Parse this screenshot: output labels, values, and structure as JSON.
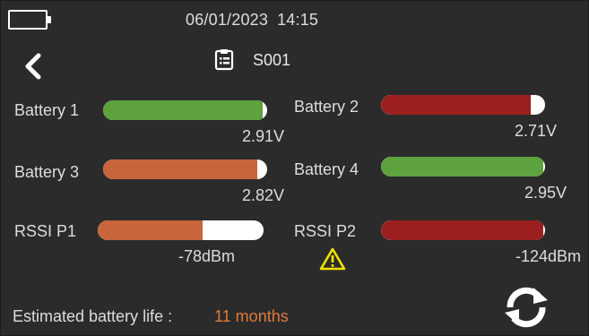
{
  "header": {
    "date": "06/01/2023",
    "time": "14:15",
    "device_battery_icon": "battery-outline-icon"
  },
  "sensor": {
    "id": "S001",
    "icon": "clipboard-icon"
  },
  "nav": {
    "back_icon": "chevron-left-icon"
  },
  "colors": {
    "green": "#5da23d",
    "red": "#9b1f1f",
    "orange": "#c9653a",
    "accent_orange": "#e07a3a",
    "warning_yellow": "#f2e200"
  },
  "gauges": [
    {
      "label": "Battery 1",
      "value": "2.91V",
      "level": 0.97,
      "color": "#5da23d"
    },
    {
      "label": "Battery 2",
      "value": "2.71V",
      "level": 0.91,
      "color": "#9b1f1f"
    },
    {
      "label": "Battery 3",
      "value": "2.82V",
      "level": 0.94,
      "color": "#c9653a"
    },
    {
      "label": "Battery 4",
      "value": "2.95V",
      "level": 0.99,
      "color": "#5da23d"
    },
    {
      "label": "RSSI P1",
      "value": "-78dBm",
      "level": 0.63,
      "color": "#c9653a"
    },
    {
      "label": "RSSI P2",
      "value": "-124dBm",
      "level": 0.99,
      "color": "#9b1f1f",
      "warning": true,
      "warning_icon": "warning-triangle-icon"
    }
  ],
  "footer": {
    "estimate_label": "Estimated battery life :",
    "estimate_value": "11 months",
    "refresh_icon": "refresh-icon"
  }
}
